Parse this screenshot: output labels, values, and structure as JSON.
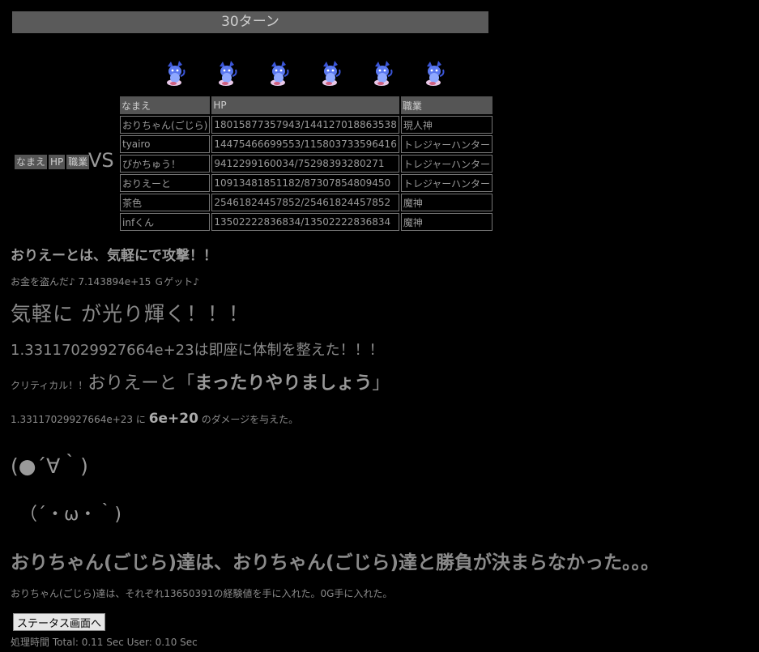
{
  "turn": "30ターン",
  "vs": "VS",
  "left_team": {
    "headers": [
      "なまえ",
      "HP",
      "職業"
    ]
  },
  "sprites": [
    "creature-icon",
    "creature-icon",
    "creature-icon",
    "creature-icon",
    "creature-icon",
    "creature-icon"
  ],
  "party": {
    "headers": [
      "なまえ",
      "HP",
      "職業"
    ],
    "rows": [
      [
        "おりちゃん(ごじら)",
        "18015877357943/144127018863538",
        "現人神"
      ],
      [
        "tyairo",
        "14475466699553/115803733596416",
        "トレジャーハンター"
      ],
      [
        "ぴかちゅう！",
        "9412299160034/75298393280271",
        "トレジャーハンター"
      ],
      [
        "おりえーと",
        "10913481851182/87307854809450",
        "トレジャーハンター"
      ],
      [
        "茶色",
        "25461824457852/25461824457852",
        "魔神"
      ],
      [
        "infくん",
        "13502222836834/13502222836834",
        "魔神"
      ]
    ]
  },
  "messages": {
    "attack": "おりえーとは、気軽にで攻撃！！",
    "steal": "お金を盗んだ♪ 7.143894e+15 Ｇゲット♪",
    "shine": "気軽に が光り輝く！！！",
    "ready": "1.33117029927664e+23は即座に体制を整えた！！！",
    "crit_label": "クリティカル！！",
    "crit_speaker": "おりえーと「",
    "crit_quote": "まったりやりましょう",
    "crit_close": "」",
    "damage_target": "1.33117029927664e+23 に ",
    "damage_value": "6e+20",
    "damage_suffix": " のダメージを与えた。",
    "face1": "(●´∀｀)",
    "face2": "（´・ω・｀)",
    "result": "おりちゃん(ごじら)達は、おりちゃん(ごじら)達と勝負が決まらなかった。。。",
    "exp": "おりちゃん(ごじら)達は、それぞれ13650391の経験値を手に入れた。0G手に入れた。"
  },
  "status_button": "ステータス画面へ",
  "timing": "処理時間 Total: 0.11 Sec User: 0.10 Sec"
}
